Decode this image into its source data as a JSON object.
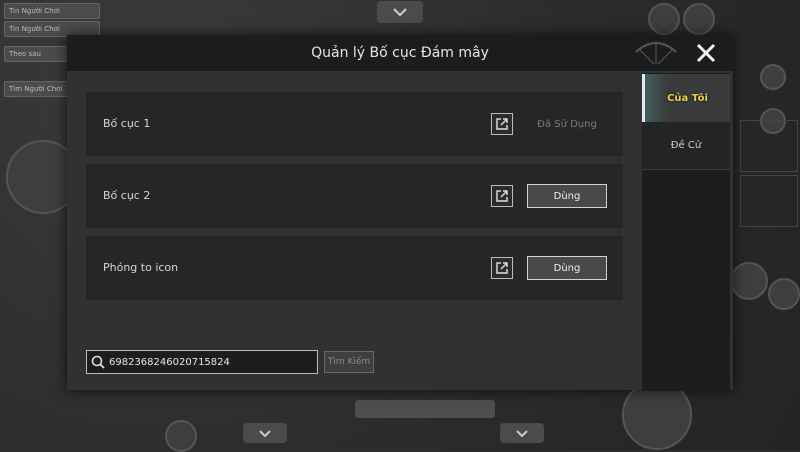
{
  "modal": {
    "title": "Quản lý Bố cục Đám mây",
    "close_icon": "close-icon"
  },
  "layouts": [
    {
      "name": "Bố cục 1",
      "action_label": "Đã Sử Dụng",
      "state": "in-use"
    },
    {
      "name": "Bố cục 2",
      "action_label": "Dùng",
      "state": "available"
    },
    {
      "name": "Phóng to icon",
      "action_label": "Dùng",
      "state": "available"
    }
  ],
  "search": {
    "value": "6982368246020715824",
    "button_label": "Tìm Kiếm",
    "icon": "search-icon"
  },
  "tabs": [
    {
      "label": "Của Tôi",
      "active": true
    },
    {
      "label": "Đề Cử",
      "active": false
    }
  ],
  "background": {
    "pill_1": "Tin Người Chơi",
    "pill_2": "Tin Người Chơi",
    "pill_3": "Theo sau",
    "pill_4": "Tìm Người Chơi"
  },
  "colors": {
    "active_tab_text": "#f0d24a",
    "header_bg": "#1b1c1d",
    "modal_bg": "#303133"
  }
}
